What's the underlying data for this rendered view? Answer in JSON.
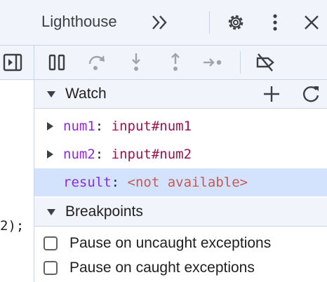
{
  "topbar": {
    "tab_title": "Lighthouse",
    "icons": [
      "more-tabs-icon",
      "settings-icon",
      "kebab-menu-icon",
      "close-icon"
    ]
  },
  "left_panel": {
    "code_fragment": "2);",
    "icons": [
      "toggle-sidebar-icon"
    ]
  },
  "debugger_toolbar": {
    "icons": [
      "pause-icon",
      "step-over-icon",
      "step-into-icon",
      "step-out-icon",
      "step-icon",
      "deactivate-breakpoints-icon"
    ]
  },
  "watch": {
    "title": "Watch",
    "icons": [
      "add-icon",
      "refresh-icon"
    ],
    "expressions": [
      {
        "name": "num1",
        "separator": ": ",
        "value": "input#num1",
        "expandable": true,
        "selected": false
      },
      {
        "name": "num2",
        "separator": ": ",
        "value": "input#num2",
        "expandable": true,
        "selected": false
      },
      {
        "name": "result",
        "separator": ": ",
        "value": "<not available>",
        "expandable": false,
        "selected": true
      }
    ]
  },
  "breakpoints": {
    "title": "Breakpoints",
    "options": [
      {
        "label": "Pause on uncaught exceptions",
        "checked": false
      },
      {
        "label": "Pause on caught exceptions",
        "checked": false
      }
    ]
  },
  "colors": {
    "toolbar_bg": "#f1f4fa",
    "border": "#c9d4e9",
    "selected_row": "#d3e3fd",
    "expression_name": "#8a2be2",
    "expression_value": "#a0104b",
    "not_available": "#c0392b"
  }
}
